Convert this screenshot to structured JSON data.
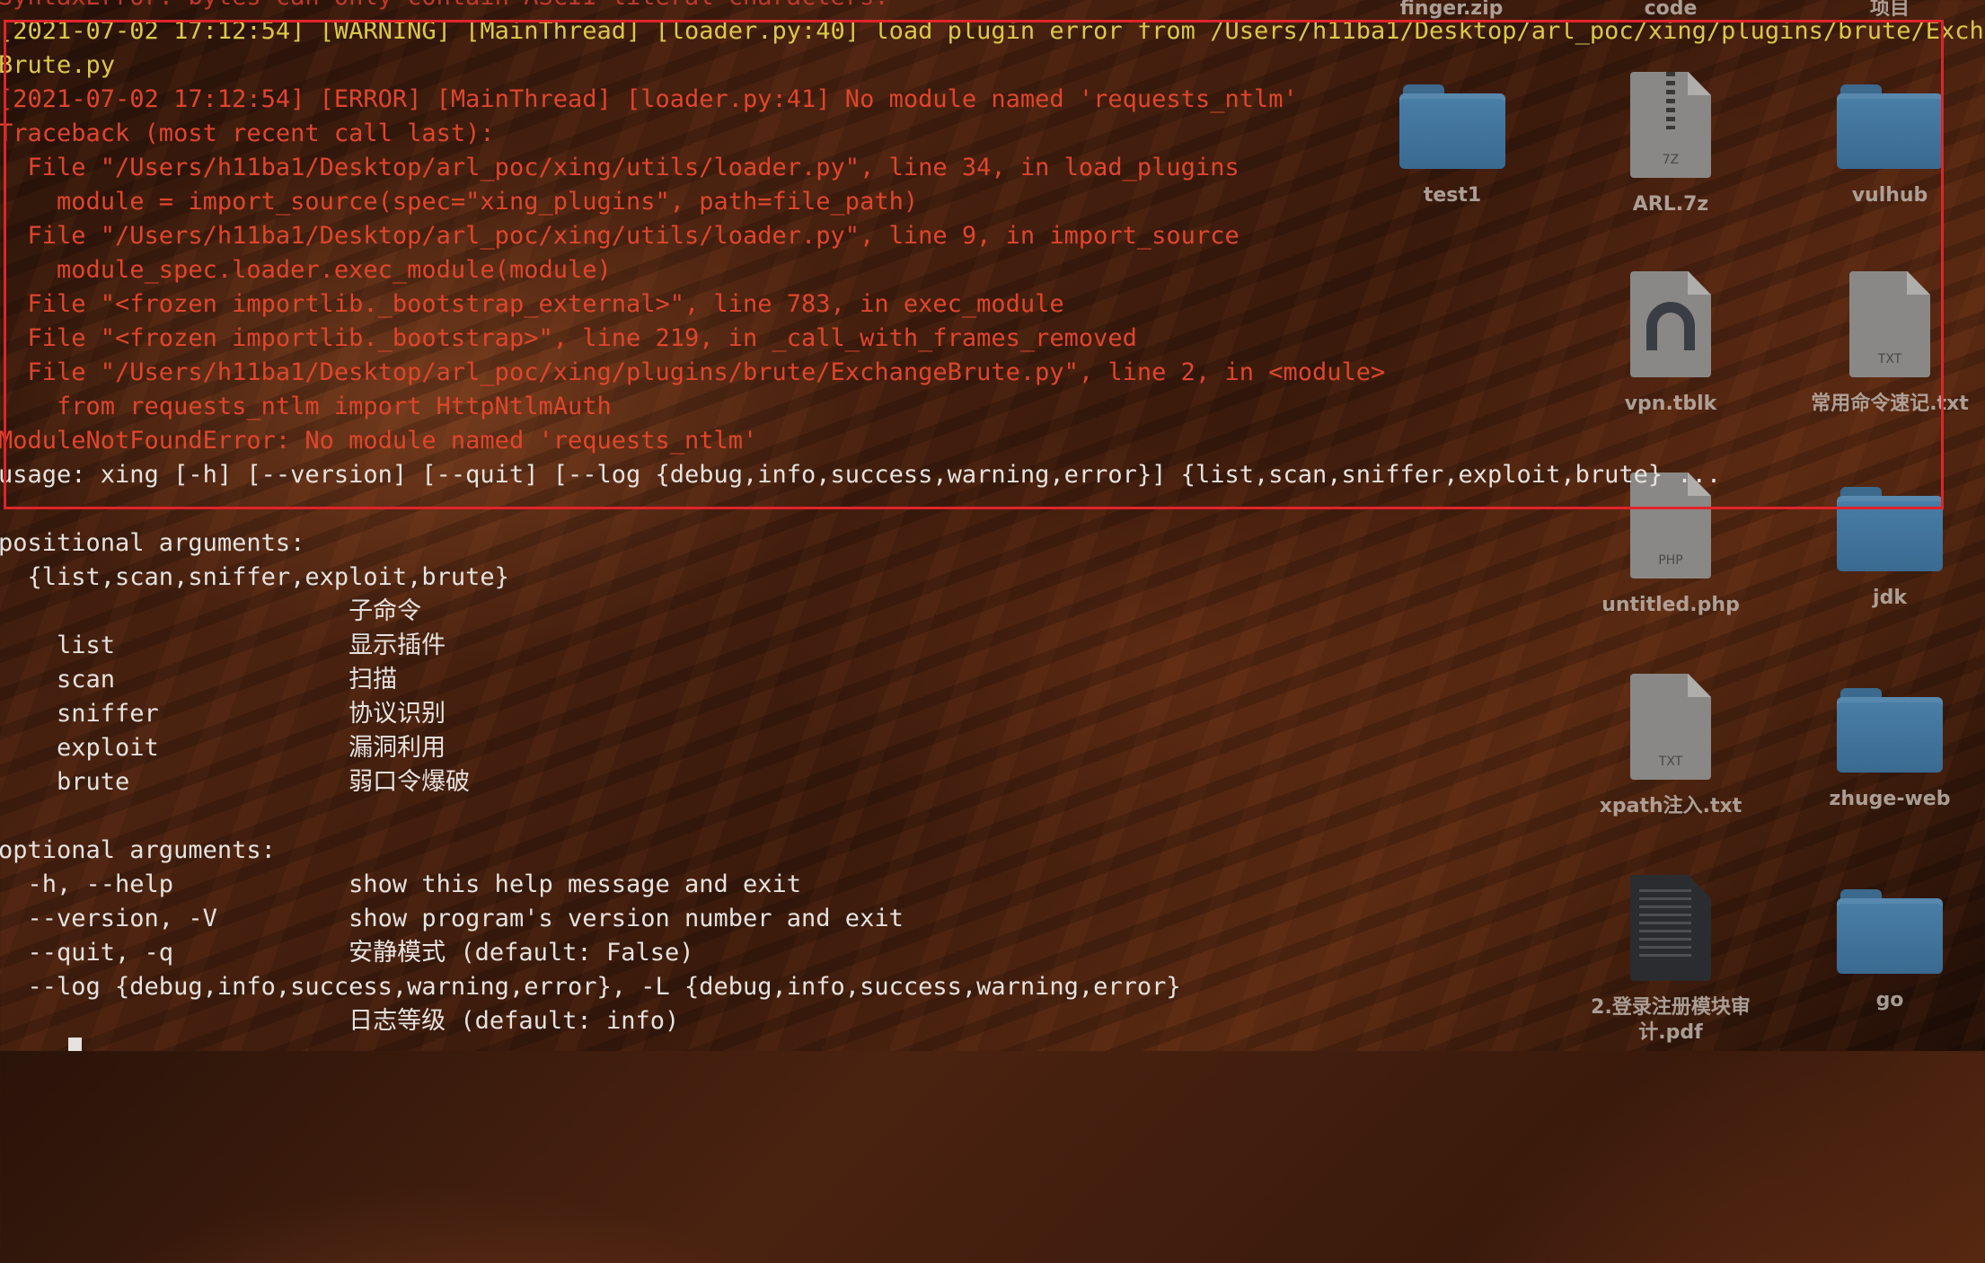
{
  "terminal": {
    "top_line": "SyntaxError: bytes can only contain ASCII literal characters.",
    "warning_line": "[2021-07-02 17:12:54] [WARNING] [MainThread] [loader.py:40] load plugin error from /Users/h11ba1/Desktop/arl_poc/xing/plugins/brute/Exchange",
    "warning_cont": "Brute.py",
    "error_line": "[2021-07-02 17:12:54] [ERROR] [MainThread] [loader.py:41] No module named 'requests_ntlm'",
    "traceback_lines": [
      "Traceback (most recent call last):",
      "  File \"/Users/h11ba1/Desktop/arl_poc/xing/utils/loader.py\", line 34, in load_plugins",
      "    module = import_source(spec=\"xing_plugins\", path=file_path)",
      "  File \"/Users/h11ba1/Desktop/arl_poc/xing/utils/loader.py\", line 9, in import_source",
      "    module_spec.loader.exec_module(module)",
      "  File \"<frozen importlib._bootstrap_external>\", line 783, in exec_module",
      "  File \"<frozen importlib._bootstrap>\", line 219, in _call_with_frames_removed",
      "  File \"/Users/h11ba1/Desktop/arl_poc/xing/plugins/brute/ExchangeBrute.py\", line 2, in <module>",
      "    from requests_ntlm import HttpNtlmAuth",
      "ModuleNotFoundError: No module named 'requests_ntlm'"
    ],
    "usage_line": "usage: xing [-h] [--version] [--quit] [--log {debug,info,success,warning,error}] {list,scan,sniffer,exploit,brute} ...",
    "help_lines": [
      "",
      "positional arguments:",
      "  {list,scan,sniffer,exploit,brute}",
      "                        子命令",
      "    list                显示插件",
      "    scan                扫描",
      "    sniffer             协议识别",
      "    exploit             漏洞利用",
      "    brute               弱口令爆破",
      "",
      "optional arguments:",
      "  -h, --help            show this help message and exit",
      "  --version, -V         show program's version number and exit",
      "  --quit, -q            安静模式 (default: False)",
      "  --log {debug,info,success,warning,error}, -L {debug,info,success,warning,error}",
      "                        日志等级 (default: info)"
    ]
  },
  "desktop": {
    "top_labels": [
      "finger.zip",
      "code",
      "项目"
    ],
    "icons": [
      {
        "label": "test1",
        "icon": "folder-icon"
      },
      {
        "label": "ARL.7z",
        "icon": "zip-file-icon",
        "ext": "7Z"
      },
      {
        "label": "vulhub",
        "icon": "folder-icon"
      },
      {
        "label": "vpn.tblk",
        "icon": "vpn-tunnel-icon"
      },
      {
        "label": "常用命令速记.txt",
        "icon": "text-file-icon",
        "ext": "TXT"
      },
      {
        "label": "untitled.php",
        "icon": "php-file-icon",
        "ext": "PHP"
      },
      {
        "label": "jdk",
        "icon": "folder-icon"
      },
      {
        "label": "xpath注入.txt",
        "icon": "text-file-icon",
        "ext": "TXT"
      },
      {
        "label": "zhuge-web",
        "icon": "folder-icon"
      },
      {
        "label": "2.登录注册模块审计.pdf",
        "icon": "pdf-file-icon"
      },
      {
        "label": "go",
        "icon": "folder-icon"
      }
    ]
  },
  "colors": {
    "warning": "#d9c84a",
    "error": "#e0452c",
    "highlight_box": "#e0242a",
    "folder": "#4a7fa8"
  }
}
